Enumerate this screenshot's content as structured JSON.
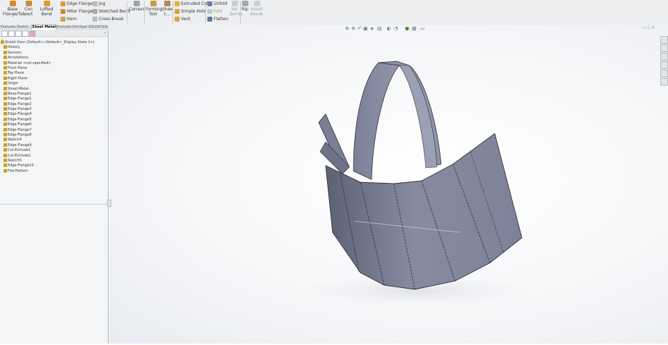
{
  "ribbon": {
    "base_flange": "Base\nFlange/Tab",
    "convert": "Con\nvert",
    "lofted_bend": "Lofted Bend",
    "edge_flange": "Edge Flange",
    "miter_flange": "Miter Flange",
    "hem": "Hem",
    "jog": "Jog",
    "sketched_bend": "Sketched Bend",
    "cross_break": "Cross-Break",
    "corners": "Corners",
    "forming_tool": "Forming\nTool",
    "sheet": "Shee\nt...",
    "extruded_cut": "Extruded Cut",
    "simple_hole": "Simple Hole",
    "vent": "Vent",
    "unfold": "Unfold",
    "fold": "Fold",
    "flatten": "Flatten",
    "no_bends": "No\nBends",
    "rip": "Rip",
    "insert_bends": "Insert\nBends"
  },
  "tabs": [
    "Features",
    "Sketch",
    "Sheet Metal",
    "Evaluate",
    "DimXpert",
    "SOLIDWORKS Add-Ins",
    "SOLIDWORKS MBD"
  ],
  "active_tab": "Sheet Metal",
  "tree": [
    "Shield Visor (Default<<Default>_Display State 1>)",
    "History",
    "Sensors",
    "Annotations",
    "Material <not specified>",
    "Front Plane",
    "Top Plane",
    "Right Plane",
    "Origin",
    "Sheet-Metal",
    "Base-Flange1",
    "Edge-Flange1",
    "Edge-Flange2",
    "Edge-Flange3",
    "Edge-Flange4",
    "Edge-Flange5",
    "Edge-Flange6",
    "Edge-Flange7",
    "Edge-Flange8",
    "Sketch4",
    "Edge-Flange9",
    "Cut-Extrude1",
    "Cut-Extrude2",
    "Sketch5",
    "Edge-Flange10",
    "Flat-Pattern"
  ],
  "colors": {
    "ribbon_bg": "#eceeef",
    "part_face": "#8a8fa3",
    "part_edge": "#2e3038",
    "tree_icon": "#c9a227"
  }
}
